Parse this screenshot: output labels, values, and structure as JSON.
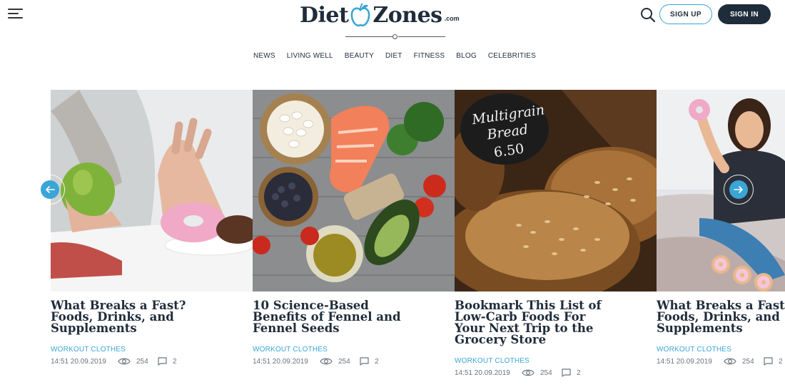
{
  "header": {
    "logo": {
      "diet": "Diet",
      "zones": "Zones",
      "com": ".com"
    },
    "signup_label": "SIGN UP",
    "signin_label": "SIGN IN"
  },
  "nav": [
    "NEWS",
    "LIVING WELL",
    "BEAUTY",
    "DIET",
    "FITNESS",
    "BLOG",
    "CELEBRITIES"
  ],
  "colors": {
    "accent": "#3aa5d6",
    "dark": "#1f2c3b"
  },
  "articles": [
    {
      "title_lines": [
        "What Breaks a Fast?",
        "Foods, Drinks, and",
        "Supplements"
      ],
      "category": "WORKOUT CLOTHES",
      "time": "14:51 20.09.2019",
      "views": "254",
      "comments": "2"
    },
    {
      "title_lines": [
        "10 Science-Based",
        "Benefits of Fennel and",
        "Fennel Seeds"
      ],
      "category": "WORKOUT CLOTHES",
      "time": "14:51 20.09.2019",
      "views": "254",
      "comments": "2"
    },
    {
      "title_lines": [
        "Bookmark This List of",
        "Low-Carb Foods For",
        "Your Next Trip to the",
        "Grocery Store"
      ],
      "category": "WORKOUT CLOTHES",
      "time": "14:51 20.09.2019",
      "views": "254",
      "comments": "2"
    },
    {
      "title_lines": [
        "What Breaks a Fast?",
        "Foods, Drinks, and",
        "Supplements"
      ],
      "category": "WORKOUT CLOTHES",
      "time": "14:51 20.09.2019",
      "views": "254",
      "comments": "2"
    }
  ],
  "image_labels": {
    "bread_sign_line1": "Multigrain",
    "bread_sign_line2": "Bread",
    "bread_sign_price": "6.50"
  },
  "icons": {
    "menu": "hamburger-icon",
    "search": "search-icon",
    "prev": "arrow-left-icon",
    "next": "arrow-right-icon",
    "views": "eye-icon",
    "comments": "comment-icon"
  }
}
